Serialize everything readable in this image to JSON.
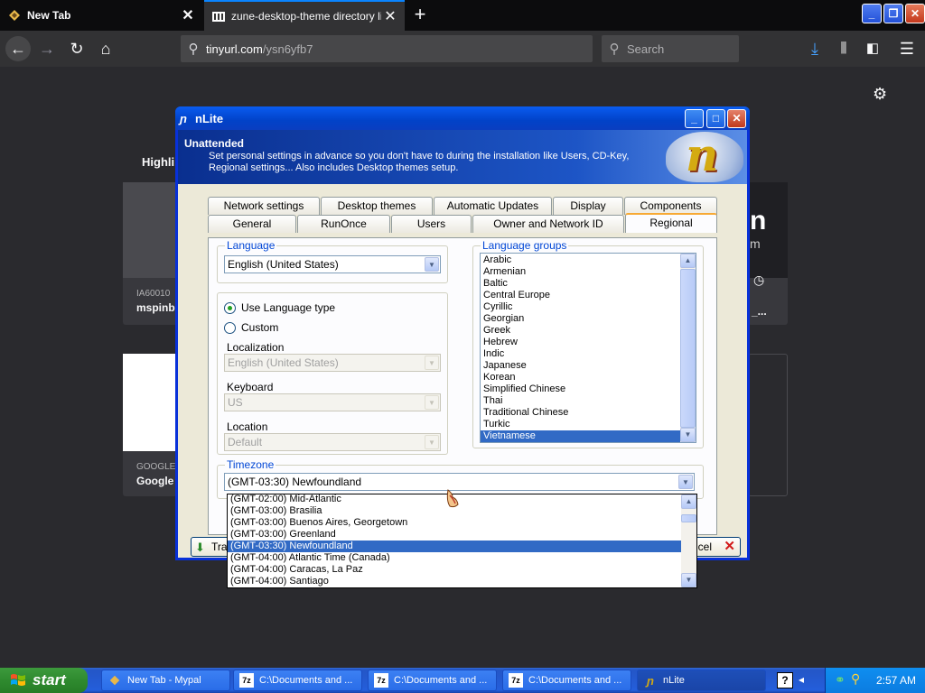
{
  "browser": {
    "tabs": [
      {
        "title": "New Tab",
        "active": true
      },
      {
        "title": "zune-desktop-theme directory list",
        "active": false
      }
    ],
    "new_tab_label": "+",
    "url": {
      "host": "tinyurl.com",
      "path": "/ysn6yfb7"
    },
    "search_placeholder": "Search",
    "accent_color": "#0a84ff"
  },
  "newtab_page": {
    "highlights_label": "Highli",
    "cards": [
      {
        "sub": "IA60010",
        "name": "mspinb"
      },
      {
        "sub": "GOOGLE",
        "name": "Google"
      }
    ],
    "partial_text_1": "n",
    "partial_text_2": "m",
    "partial_text_3": "_..."
  },
  "nlite": {
    "title": "nLite",
    "banner": {
      "title": "Unattended",
      "description": "Set personal settings in advance so you don't have to during the installation like Users, CD-Key, Regional settings... Also includes Desktop themes setup."
    },
    "tabs_row1": [
      "Network settings",
      "Desktop themes",
      "Automatic Updates",
      "Display",
      "Components"
    ],
    "tabs_row2": [
      "General",
      "RunOnce",
      "Users",
      "Owner and Network ID",
      "Regional"
    ],
    "active_tab": "Regional",
    "language": {
      "group_label": "Language",
      "selected": "English (United States)"
    },
    "options": {
      "use_language_type": "Use Language type",
      "custom": "Custom",
      "localization_label": "Localization",
      "localization_value": "English (United States)",
      "keyboard_label": "Keyboard",
      "keyboard_value": "US",
      "location_label": "Location",
      "location_value": "Default"
    },
    "language_groups": {
      "group_label": "Language groups",
      "items": [
        "Arabic",
        "Armenian",
        "Baltic",
        "Central Europe",
        "Cyrillic",
        "Georgian",
        "Greek",
        "Hebrew",
        "Indic",
        "Japanese",
        "Korean",
        "Simplified Chinese",
        "Thai",
        "Traditional Chinese",
        "Turkic",
        "Vietnamese"
      ],
      "selected": "Vietnamese"
    },
    "timezone": {
      "group_label": "Timezone",
      "selected": "(GMT-03:30) Newfoundland",
      "options": [
        "(GMT-02:00) Mid-Atlantic",
        "(GMT-03:00) Brasilia",
        "(GMT-03:00) Buenos Aires, Georgetown",
        "(GMT-03:00) Greenland",
        "(GMT-03:30) Newfoundland",
        "(GMT-04:00) Atlantic Time (Canada)",
        "(GMT-04:00) Caracas, La Paz",
        "(GMT-04:00) Santiago"
      ]
    },
    "bottom": {
      "left_button": "Tra",
      "cancel_button": "ncel"
    }
  },
  "taskbar": {
    "start_label": "start",
    "tasks": [
      {
        "label": "New Tab - Mypal",
        "active": false
      },
      {
        "label": "C:\\Documents and ...",
        "active": false
      },
      {
        "label": "C:\\Documents and ...",
        "active": false
      },
      {
        "label": "C:\\Documents and ...",
        "active": false
      },
      {
        "label": "nLite",
        "active": true
      }
    ],
    "clock": "2:57 AM",
    "help_label": "?"
  }
}
